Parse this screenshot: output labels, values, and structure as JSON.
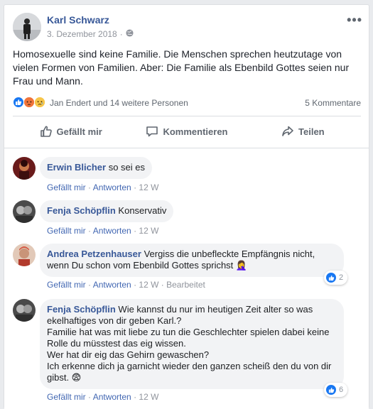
{
  "post": {
    "author": "Karl Schwarz",
    "date": "3. Dezember 2018",
    "separator": "·",
    "text": "Homosexuelle sind keine Familie. Die Menschen sprechen heutzutage von vielen Formen von Familien. Aber: Die Familie als Ebenbild Gottes seien nur Frau und Mann.",
    "reactions_text": "Jan Endert und 14 weitere Personen",
    "comment_count": "5 Kommentare"
  },
  "actions": {
    "like": "Gefällt mir",
    "comment": "Kommentieren",
    "share": "Teilen"
  },
  "comment_actions": {
    "like": "Gefällt mir",
    "reply": "Antworten",
    "dot": "·"
  },
  "comments": [
    {
      "name": "Erwin Blicher",
      "text": "so sei es",
      "time": "12 W"
    },
    {
      "name": "Fenja Schöpflin",
      "text": "Konservativ",
      "time": "12 W"
    },
    {
      "name": "Andrea Petzenhauser",
      "text": "Vergiss die unbefleckte Empfängnis nicht, wenn Du schon vom Ebenbild Gottes sprichst 🤦‍♀️",
      "time": "12 W",
      "edited": "Bearbeitet",
      "likes": "2"
    },
    {
      "name": "Fenja Schöpflin",
      "text_lines": [
        "Wie kannst du nur im heutigen Zeit alter so was ekelhaftiges von dir geben Karl.?",
        "Familie hat was mit liebe zu tun die Geschlechter spielen dabei keine Rolle du müsstest das eig wissen.",
        "Wer hat dir eig das Gehirn gewaschen?",
        "Ich erkenne dich ja garnicht wieder den ganzen scheiß den du von dir gibst. 😨"
      ],
      "time": "12 W",
      "likes": "6"
    }
  ],
  "colors": {
    "link": "#385898",
    "accent": "#4267b2",
    "muted": "#90949c",
    "bubble": "#f2f3f5"
  }
}
